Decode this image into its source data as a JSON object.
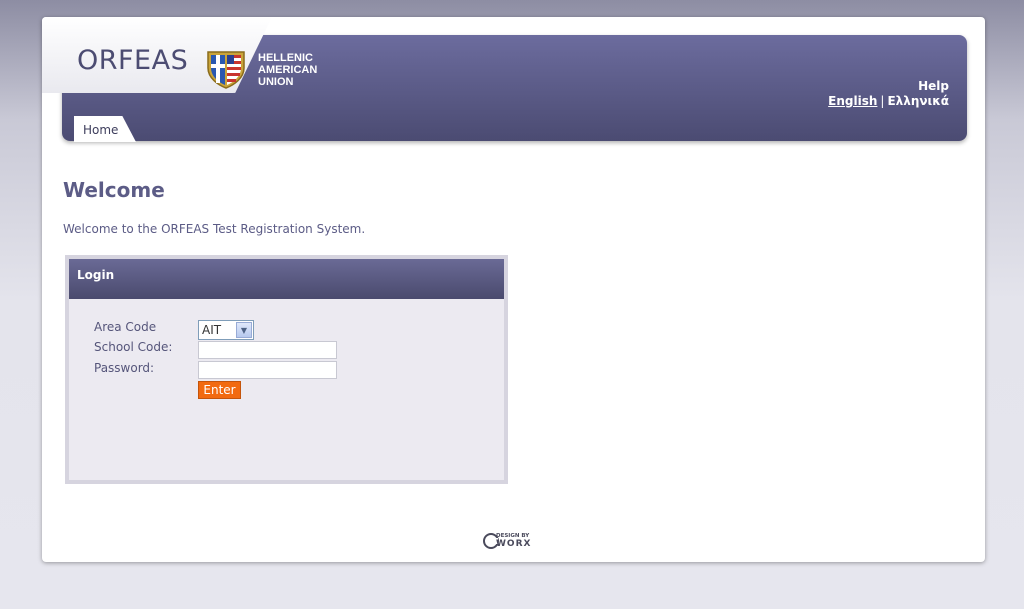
{
  "header": {
    "logo": "ORFEAS",
    "org_line1": "HELLENIC",
    "org_line2": "AMERICAN",
    "org_line3": "UNION",
    "help": "Help",
    "lang_english": "English",
    "lang_separator": "|",
    "lang_greek": "Ελληνικά",
    "crest_icon": "hau-crest-icon"
  },
  "nav": {
    "home": "Home"
  },
  "main": {
    "title": "Welcome",
    "intro": "Welcome to the ORFEAS Test Registration System."
  },
  "login": {
    "title": "Login",
    "area_code_label": "Area Code",
    "area_code_value": "AIT",
    "school_code_label": "School Code:",
    "school_code_value": "",
    "password_label": "Password:",
    "password_value": "",
    "enter_label": "Enter"
  },
  "footer": {
    "design_by": "DESIGN BY",
    "brand": "WORX"
  },
  "colors": {
    "header_purple": "#5a5a86",
    "accent_orange": "#f26a10",
    "text_purple": "#5c5c86"
  }
}
